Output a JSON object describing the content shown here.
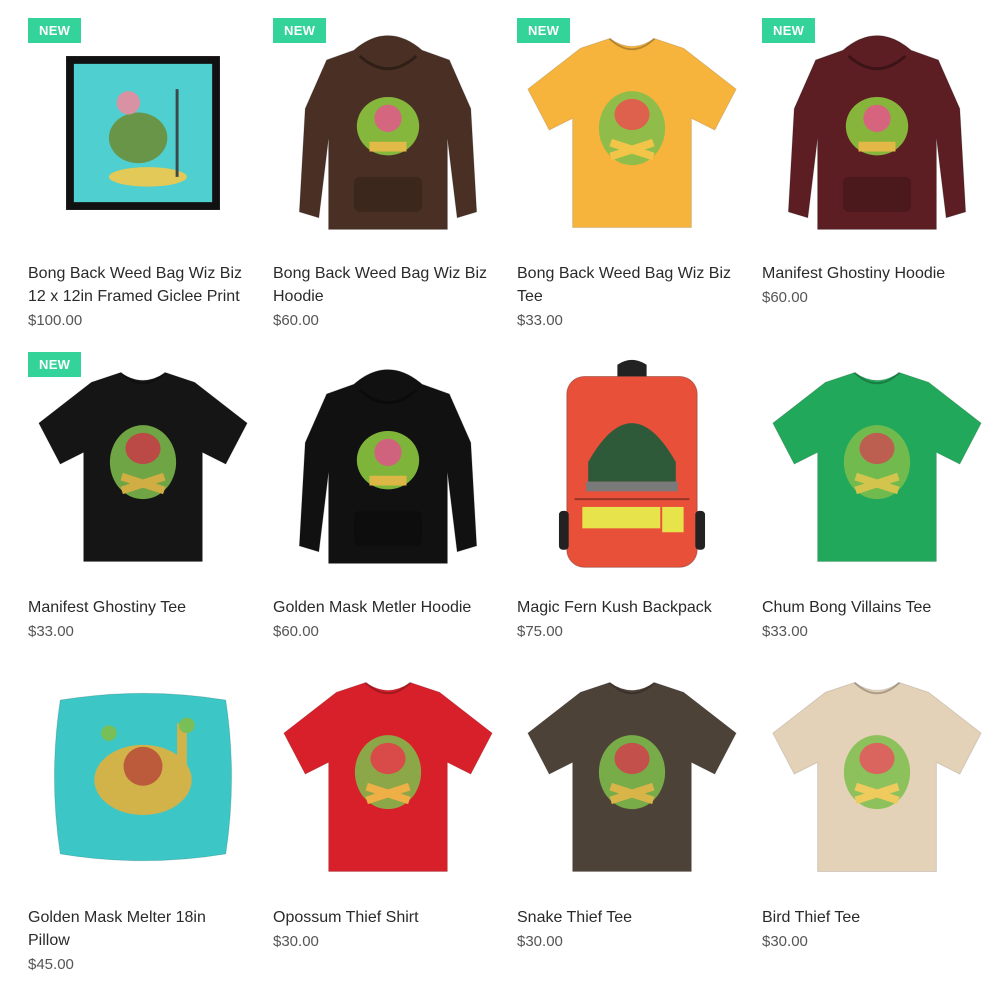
{
  "badge_text": "NEW",
  "products": [
    {
      "title_line1": "Bong Back Weed Bag Wiz Biz",
      "title_line2": "12 x 12in Framed Giclee Print",
      "price": "$100.00",
      "is_new": true,
      "kind": "print-frame",
      "color": "#4fcfcf"
    },
    {
      "title_line1": "Bong Back Weed Bag Wiz Biz",
      "title_line2": "Hoodie",
      "price": "$60.00",
      "is_new": true,
      "kind": "hoodie",
      "color": "#4a3024"
    },
    {
      "title_line1": "Bong Back Weed Bag Wiz Biz",
      "title_line2": "Tee",
      "price": "$33.00",
      "is_new": true,
      "kind": "tee",
      "color": "#f6b43c"
    },
    {
      "title_line1": "Manifest Ghostiny Hoodie",
      "title_line2": "",
      "price": "$60.00",
      "is_new": true,
      "kind": "hoodie",
      "color": "#5c1e22"
    },
    {
      "title_line1": "Manifest Ghostiny Tee",
      "title_line2": "",
      "price": "$33.00",
      "is_new": true,
      "kind": "tee",
      "color": "#151515"
    },
    {
      "title_line1": "Golden Mask Metler Hoodie",
      "title_line2": "",
      "price": "$60.00",
      "is_new": false,
      "kind": "hoodie",
      "color": "#111111"
    },
    {
      "title_line1": "Magic Fern Kush Backpack",
      "title_line2": "",
      "price": "$75.00",
      "is_new": false,
      "kind": "backpack",
      "color": "#e8503a"
    },
    {
      "title_line1": "Chum Bong Villains Tee",
      "title_line2": "",
      "price": "$33.00",
      "is_new": false,
      "kind": "tee",
      "color": "#22a85a"
    },
    {
      "title_line1": "Golden Mask Melter 18in",
      "title_line2": "Pillow",
      "price": "$45.00",
      "is_new": false,
      "kind": "pillow",
      "color": "#3cc6c6"
    },
    {
      "title_line1": "Opossum Thief Shirt",
      "title_line2": "",
      "price": "$30.00",
      "is_new": false,
      "kind": "tee",
      "color": "#d8202a"
    },
    {
      "title_line1": "Snake Thief Tee",
      "title_line2": "",
      "price": "$30.00",
      "is_new": false,
      "kind": "tee",
      "color": "#4d4238"
    },
    {
      "title_line1": "Bird Thief Tee",
      "title_line2": "",
      "price": "$30.00",
      "is_new": false,
      "kind": "tee",
      "color": "#e4d2b8"
    }
  ]
}
